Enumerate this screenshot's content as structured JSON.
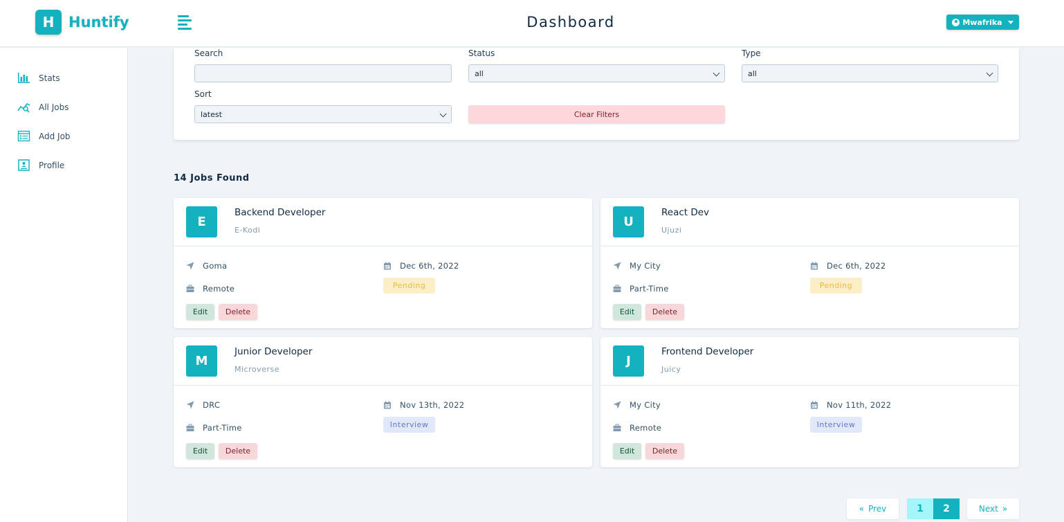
{
  "brand": {
    "logo_letter": "H",
    "name": "Huntify"
  },
  "header": {
    "title": "Dashboard",
    "user_name": "Mwafrika"
  },
  "sidebar": {
    "items": [
      {
        "label": "Stats",
        "icon": "bar-chart-icon"
      },
      {
        "label": "All Jobs",
        "icon": "search-chart-icon"
      },
      {
        "label": "Add Job",
        "icon": "form-icon"
      },
      {
        "label": "Profile",
        "icon": "id-card-icon"
      }
    ]
  },
  "filters": {
    "search_label": "Search",
    "search_value": "",
    "status_label": "Status",
    "status_value": "all",
    "type_label": "Type",
    "type_value": "all",
    "sort_label": "Sort",
    "sort_value": "latest",
    "clear_label": "Clear Filters"
  },
  "jobs_found": "14 Jobs Found",
  "jobs": [
    {
      "letter": "E",
      "position": "Backend Developer",
      "company": "E-Kodi",
      "location": "Goma",
      "date": "Dec 6th, 2022",
      "type": "Remote",
      "status": "Pending",
      "status_kind": "pending"
    },
    {
      "letter": "U",
      "position": "React Dev",
      "company": "Ujuzi",
      "location": "My City",
      "date": "Dec 6th, 2022",
      "type": "Part-Time",
      "status": "Pending",
      "status_kind": "pending"
    },
    {
      "letter": "M",
      "position": "Junior Developer",
      "company": "Microverse",
      "location": "DRC",
      "date": "Nov 13th, 2022",
      "type": "Part-Time",
      "status": "Interview",
      "status_kind": "interview"
    },
    {
      "letter": "J",
      "position": "Frontend Developer",
      "company": "Juicy",
      "location": "My City",
      "date": "Nov 11th, 2022",
      "type": "Remote",
      "status": "Interview",
      "status_kind": "interview"
    }
  ],
  "job_actions": {
    "edit": "Edit",
    "delete": "Delete"
  },
  "pagination": {
    "prev": "Prev",
    "next": "Next",
    "pages": [
      "1",
      "2"
    ],
    "current": "2"
  },
  "colors": {
    "primary": "#14b2be",
    "pending_bg": "#fcefc7",
    "pending_text": "#e9b949",
    "interview_bg": "#e0e8f9",
    "interview_text": "#647acb"
  }
}
